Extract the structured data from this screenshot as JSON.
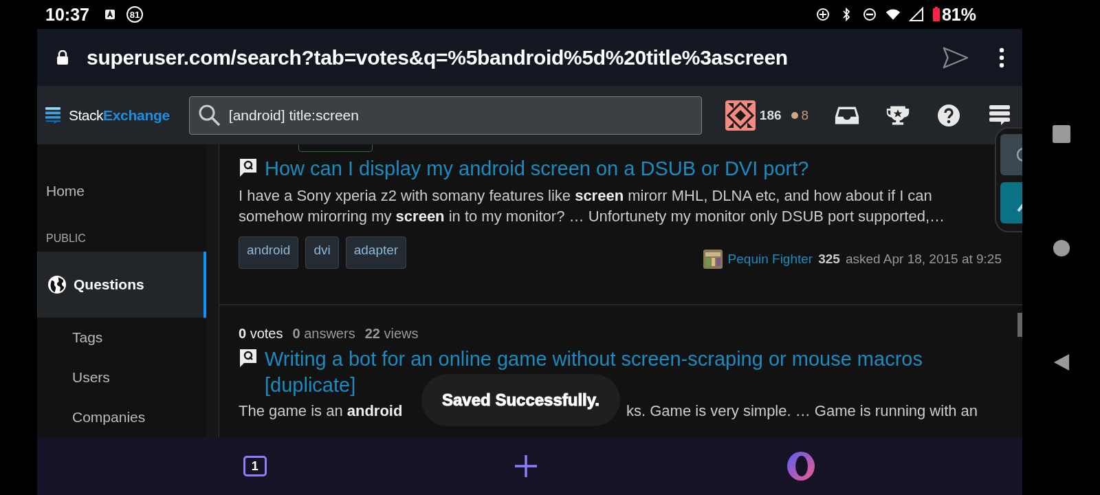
{
  "status_bar": {
    "time": "10:37",
    "notification_count": "81",
    "battery": "81%"
  },
  "address_bar": {
    "url": "superuser.com/search?tab=votes&q=%5bandroid%5d%20title%3ascreen"
  },
  "header": {
    "logo_first": "Stack",
    "logo_second": "Exchange",
    "search": {
      "value": "[android] title:screen"
    },
    "reputation": "186",
    "bronze_badges": "8"
  },
  "sidebar": {
    "items": [
      {
        "label": "Home",
        "kind": "top",
        "selected": false
      },
      {
        "label": "PUBLIC",
        "kind": "section"
      },
      {
        "label": "Questions",
        "kind": "main",
        "selected": true
      },
      {
        "label": "Tags",
        "kind": "sub",
        "selected": false
      },
      {
        "label": "Users",
        "kind": "sub",
        "selected": false
      },
      {
        "label": "Companies",
        "kind": "sub",
        "selected": false
      }
    ]
  },
  "results": [
    {
      "title": "How can I display my android screen on a DSUB or DVI port?",
      "excerpt": "I have a Sony xperia z2 with somany features like **screen** mirorr MHL, DLNA etc, and how about if I can somehow mirorring my **screen** in to my monitor? … Unfortunety my monitor only DSUB port supported,…",
      "tags": [
        "android",
        "dvi",
        "adapter"
      ],
      "author": "Pequin Fighter",
      "author_reputation": "325",
      "asked": "asked Apr 18, 2015 at 9:25"
    },
    {
      "votes": "0",
      "votes_label": "votes",
      "answers": "0",
      "answers_label": "answers",
      "views": "22",
      "views_label": "views",
      "title": "Writing a bot for an online game without screen-scraping or mouse macros [duplicate]",
      "excerpt_visible": [
        "The game is an **android**",
        "ks. Game is very simple. … Game is running with an"
      ]
    }
  ],
  "toast": "Saved Successfully.",
  "bottom_bar": {
    "tab_count": "1"
  }
}
